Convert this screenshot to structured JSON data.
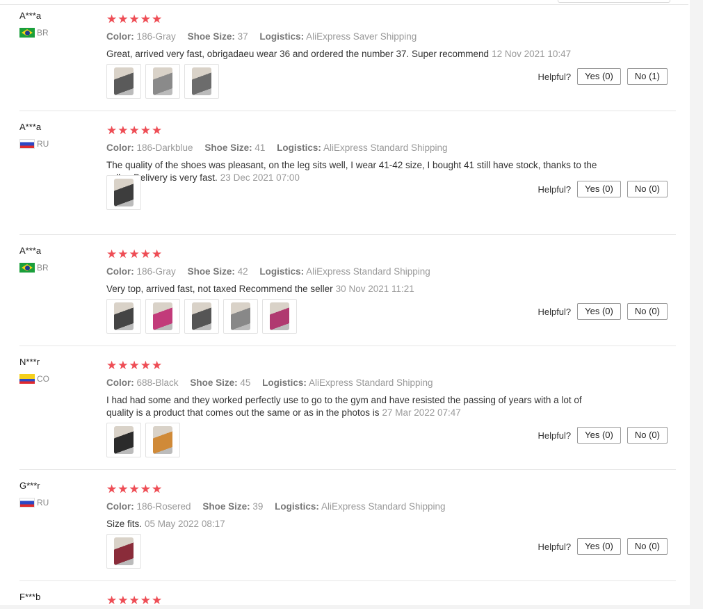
{
  "labels": {
    "color": "Color:",
    "shoe_size": "Shoe Size:",
    "logistics": "Logistics:",
    "helpful": "Helpful?",
    "stars": "★★★★★"
  },
  "reviews": [
    {
      "user": "A***a",
      "country": "BR",
      "flag": "brazil-flag",
      "rating": 5,
      "color": "186-Gray",
      "shoe_size": "37",
      "logistics": "AliExpress Saver Shipping",
      "text": "Great, arrived very fast, obrigadaeu wear 36 and ordered the number 37. Super recommend",
      "date": "12 Nov 2021 10:47",
      "photos": [
        "shoe-photo",
        "shoe-photo",
        "shoe-photo"
      ],
      "yes": "Yes (0)",
      "no": "No (1)"
    },
    {
      "user": "A***a",
      "country": "RU",
      "flag": "russia-flag",
      "rating": 5,
      "color": "186-Darkblue",
      "shoe_size": "41",
      "logistics": "AliExpress Standard Shipping",
      "text": "The quality of the shoes was pleasant, on the leg sits well, I wear 41-42 size, I bought 41 still have stock, thanks to the seller. Delivery is very fast.",
      "date": "23 Dec 2021 07:00",
      "photos": [
        "shoe-photo"
      ],
      "yes": "Yes (0)",
      "no": "No (0)"
    },
    {
      "user": "A***a",
      "country": "BR",
      "flag": "brazil-flag",
      "rating": 5,
      "color": "186-Gray",
      "shoe_size": "42",
      "logistics": "AliExpress Standard Shipping",
      "text": "Very top, arrived fast, not taxed Recommend the seller",
      "date": "30 Nov 2021 11:21",
      "photos": [
        "shoe-photo",
        "shoe-photo",
        "shoe-photo",
        "shoe-photo",
        "shoe-photo"
      ],
      "yes": "Yes (0)",
      "no": "No (0)"
    },
    {
      "user": "N***r",
      "country": "CO",
      "flag": "colombia-flag",
      "rating": 5,
      "color": "688-Black",
      "shoe_size": "45",
      "logistics": "AliExpress Standard Shipping",
      "text": "I had had some and they worked perfectly use to go to the gym and have resisted the passing of years with a lot of quality is a product that comes out the same or as in the photos is",
      "date": "27 Mar 2022 07:47",
      "photos": [
        "shoe-photo",
        "shoe-photo"
      ],
      "yes": "Yes (0)",
      "no": "No (0)"
    },
    {
      "user": "G***r",
      "country": "RU",
      "flag": "russia-flag",
      "rating": 5,
      "color": "186-Rosered",
      "shoe_size": "39",
      "logistics": "AliExpress Standard Shipping",
      "text": "Size fits.",
      "date": "05 May 2022 08:17",
      "photos": [
        "shoe-photo"
      ],
      "yes": "Yes (0)",
      "no": "No (0)"
    }
  ],
  "partial_review": {
    "user": "F***b"
  }
}
